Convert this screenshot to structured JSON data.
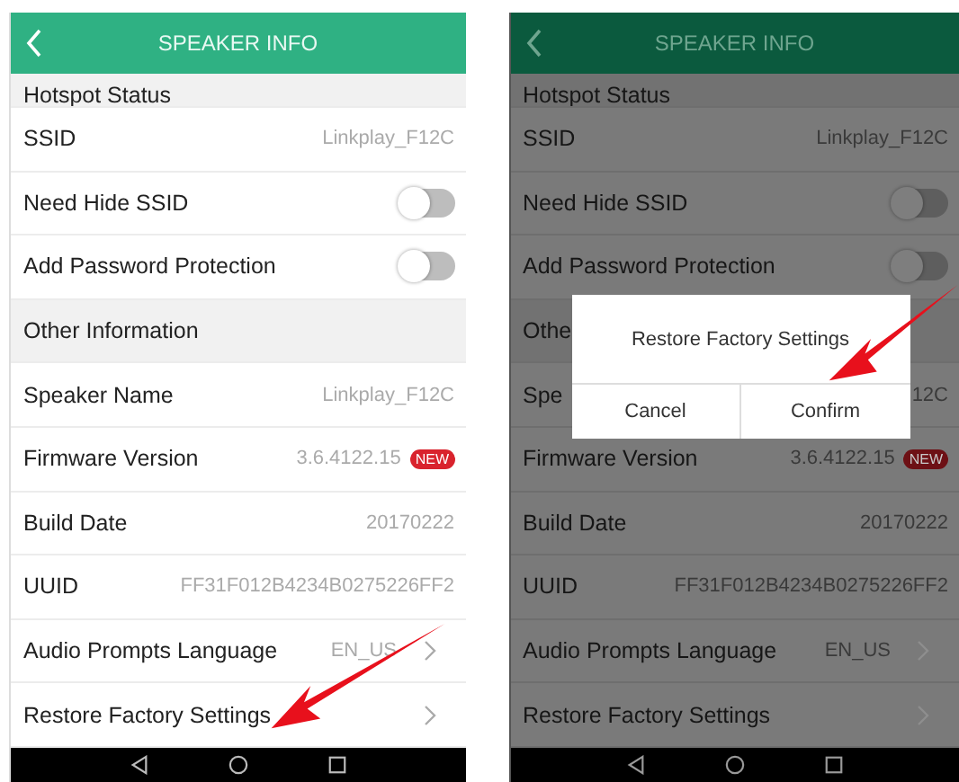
{
  "screens": [
    {
      "dimmed": false,
      "title": "SPEAKER INFO",
      "rows": [
        {
          "kind": "partial",
          "label": "Hotspot Status"
        },
        {
          "kind": "value",
          "label": "SSID",
          "value": "Linkplay_F12C"
        },
        {
          "kind": "toggle",
          "label": "Need Hide SSID",
          "on": false
        },
        {
          "kind": "toggle",
          "label": "Add Password Protection",
          "on": false
        },
        {
          "kind": "header",
          "label": "Other Information"
        },
        {
          "kind": "value",
          "label": "Speaker Name",
          "value": "Linkplay_F12C"
        },
        {
          "kind": "value",
          "label": "Firmware Version",
          "value": "3.6.4122.15",
          "badge": "NEW"
        },
        {
          "kind": "value",
          "label": "Build Date",
          "value": "20170222"
        },
        {
          "kind": "value",
          "label": "UUID",
          "value": "FF31F012B4234B0275226FF2"
        },
        {
          "kind": "link",
          "label": "Audio Prompts Language",
          "value": "EN_US"
        },
        {
          "kind": "link",
          "label": "Restore Factory Settings"
        }
      ]
    },
    {
      "dimmed": true,
      "title": "SPEAKER INFO",
      "rows": [
        {
          "kind": "partial",
          "label": "Hotspot Status"
        },
        {
          "kind": "value",
          "label": "SSID",
          "value": "Linkplay_F12C"
        },
        {
          "kind": "toggle",
          "label": "Need Hide SSID",
          "on": false
        },
        {
          "kind": "toggle",
          "label": "Add Password Protection",
          "on": false
        },
        {
          "kind": "header",
          "label": "Othe"
        },
        {
          "kind": "value",
          "label": "Spe",
          "value": "12C"
        },
        {
          "kind": "value",
          "label": "Firmware Version",
          "value": "3.6.4122.15",
          "badge": "NEW"
        },
        {
          "kind": "value",
          "label": "Build Date",
          "value": "20170222"
        },
        {
          "kind": "value",
          "label": "UUID",
          "value": "FF31F012B4234B0275226FF2"
        },
        {
          "kind": "link",
          "label": "Audio Prompts Language",
          "value": "EN_US"
        },
        {
          "kind": "link",
          "label": "Restore Factory Settings"
        }
      ],
      "dialog": {
        "title": "Restore Factory Settings",
        "buttons": [
          "Cancel",
          "Confirm"
        ]
      }
    }
  ]
}
